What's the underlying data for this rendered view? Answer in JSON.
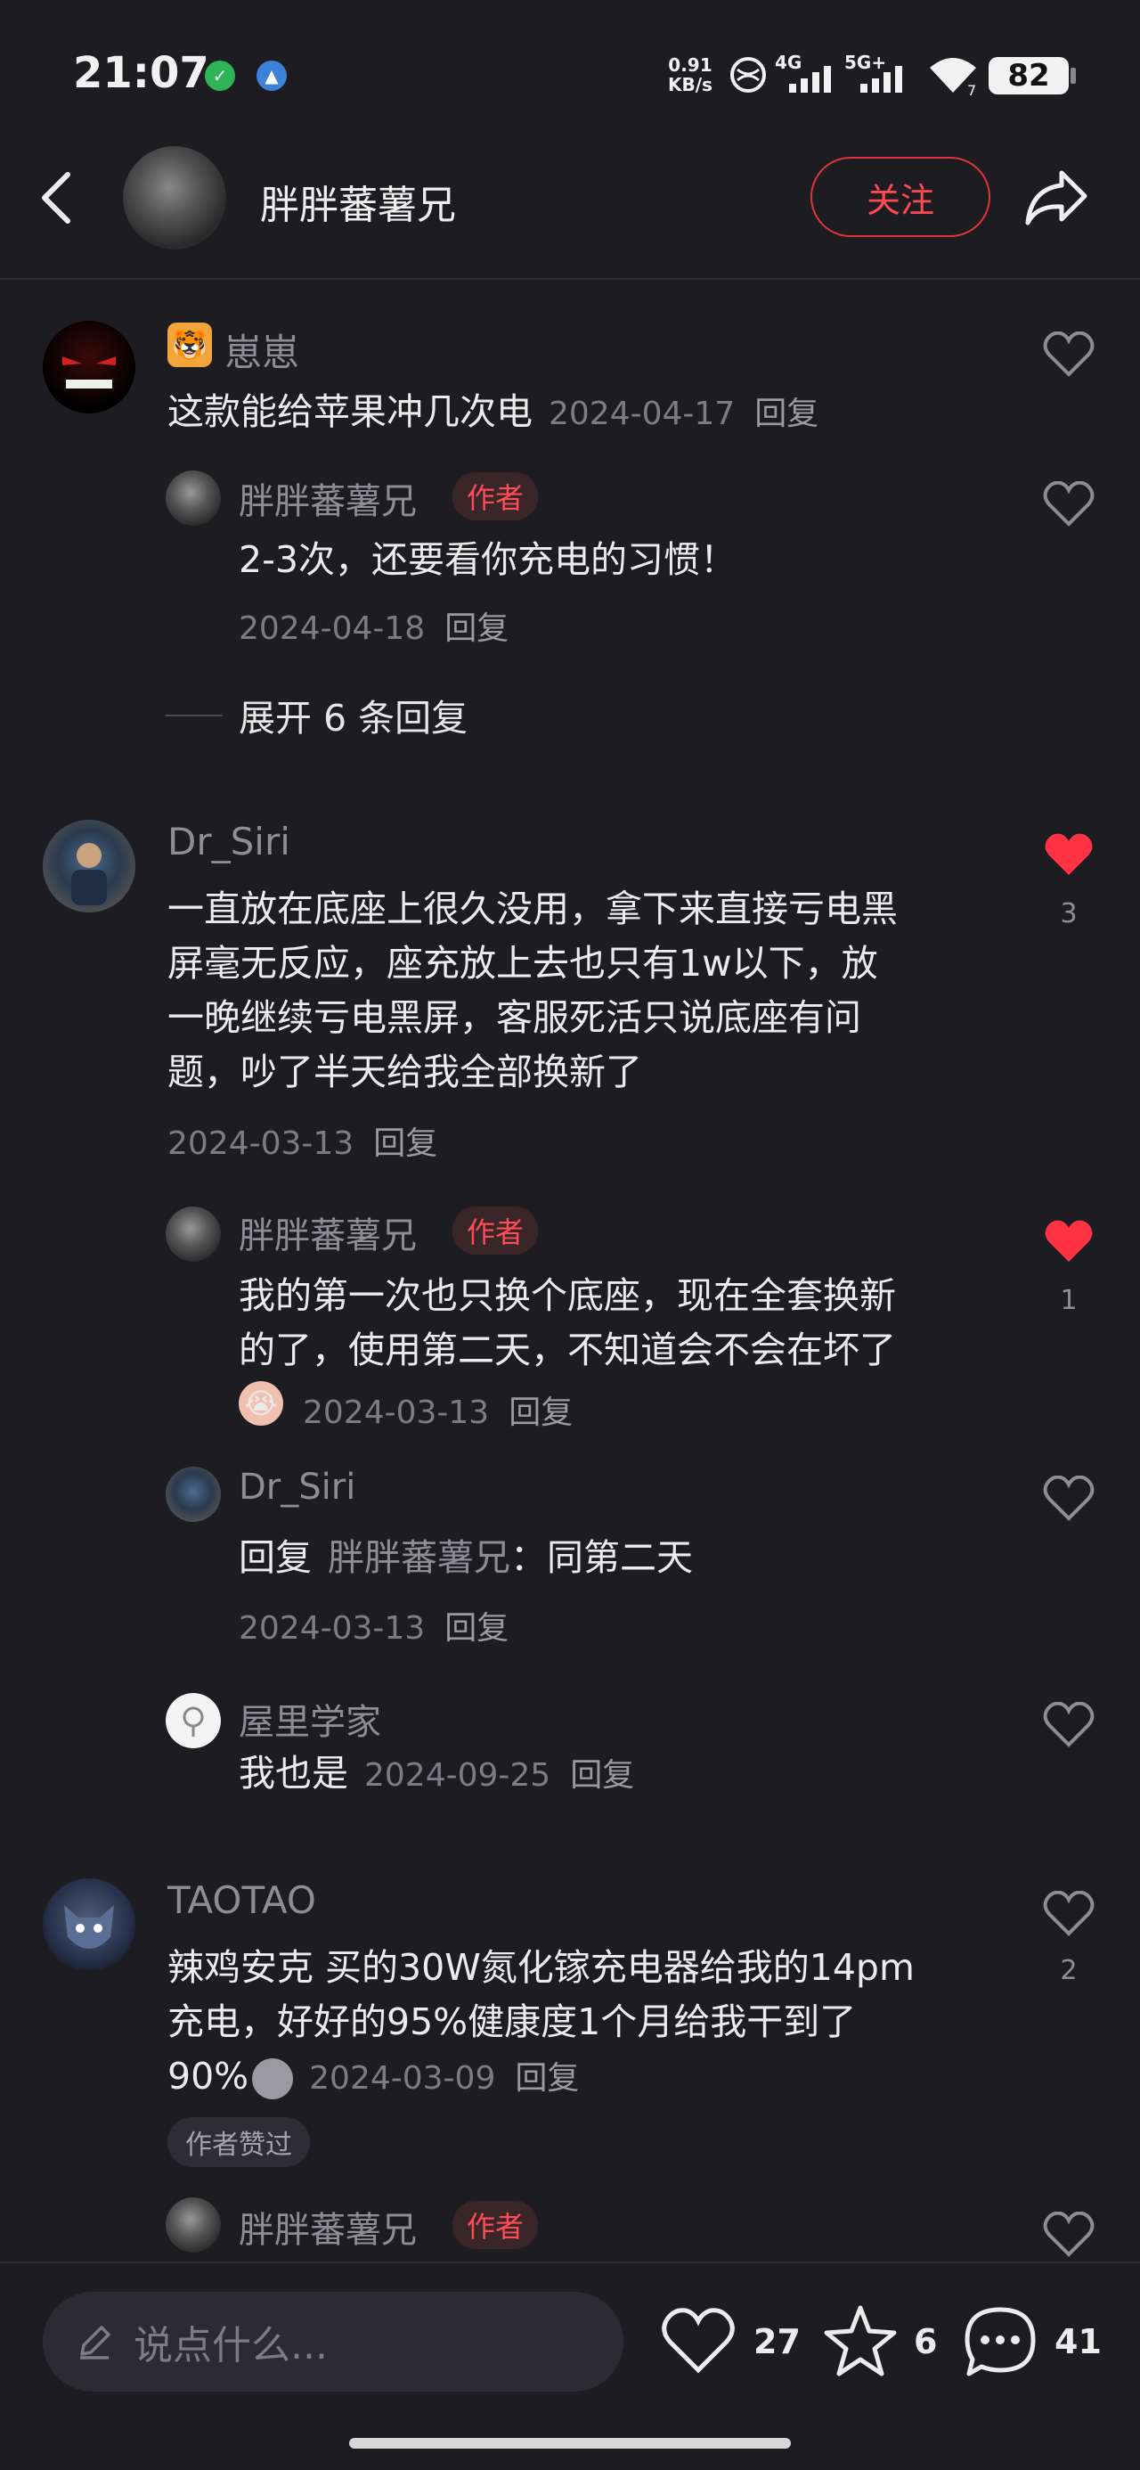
{
  "status_bar": {
    "time": "21:07",
    "net_speed_value": "0.91",
    "net_speed_unit": "KB/s",
    "signal_1": "4G",
    "signal_2": "5G+",
    "wifi_level": "7",
    "battery": "82"
  },
  "header": {
    "user_name": "胖胖蕃薯兄",
    "follow_label": "关注"
  },
  "comments": [
    {
      "user": "崽崽",
      "text": "这款能给苹果冲几次电",
      "date": "2024-04-17",
      "reply": "回复",
      "likes": "",
      "replies": [
        {
          "user": "胖胖蕃薯兄",
          "tag": "作者",
          "text": "2-3次，还要看你充电的习惯！",
          "date": "2024-04-18",
          "reply": "回复"
        }
      ],
      "expand_label": "展开 6 条回复"
    },
    {
      "user": "Dr_Siri",
      "text_lines": [
        "一直放在底座上很久没用，拿下来直接亏电黑",
        "屏毫无反应，座充放上去也只有1w以下，放",
        "一晚继续亏电黑屏，客服死活只说底座有问",
        "题，吵了半天给我全部换新了"
      ],
      "date": "2024-03-13",
      "reply": "回复",
      "likes": "3",
      "replies": [
        {
          "user": "胖胖蕃薯兄",
          "tag": "作者",
          "text_lines": [
            "我的第一次也只换个底座，现在全套换新",
            "的了，使用第二天，不知道会不会在坏了"
          ],
          "date": "2024-03-13",
          "reply": "回复",
          "likes": "1"
        },
        {
          "user": "Dr_Siri",
          "reply_prefix": "回复",
          "reply_to": "胖胖蕃薯兄",
          "text": "：同第二天",
          "date": "2024-03-13",
          "reply": "回复"
        },
        {
          "user": "屋里学家",
          "text": "我也是",
          "date": "2024-09-25",
          "reply": "回复"
        }
      ]
    },
    {
      "user": "TAOTAO",
      "text_lines": [
        "辣鸡安克 买的30W氮化镓充电器给我的14pm",
        "充电，好好的95%健康度1个月给我干到了",
        "90%"
      ],
      "date": "2024-03-09",
      "reply": "回复",
      "likes": "2",
      "liked_tag": "作者赞过",
      "replies": [
        {
          "user": "胖胖蕃薯兄",
          "tag": "作者"
        }
      ]
    }
  ],
  "bottom_bar": {
    "input_placeholder": "说点什么...",
    "likes": "27",
    "favorites": "6",
    "comments": "41"
  },
  "colors": {
    "background": "#1c1c21",
    "accent_red": "#ff4a55",
    "muted_text": "#8d8d93"
  }
}
